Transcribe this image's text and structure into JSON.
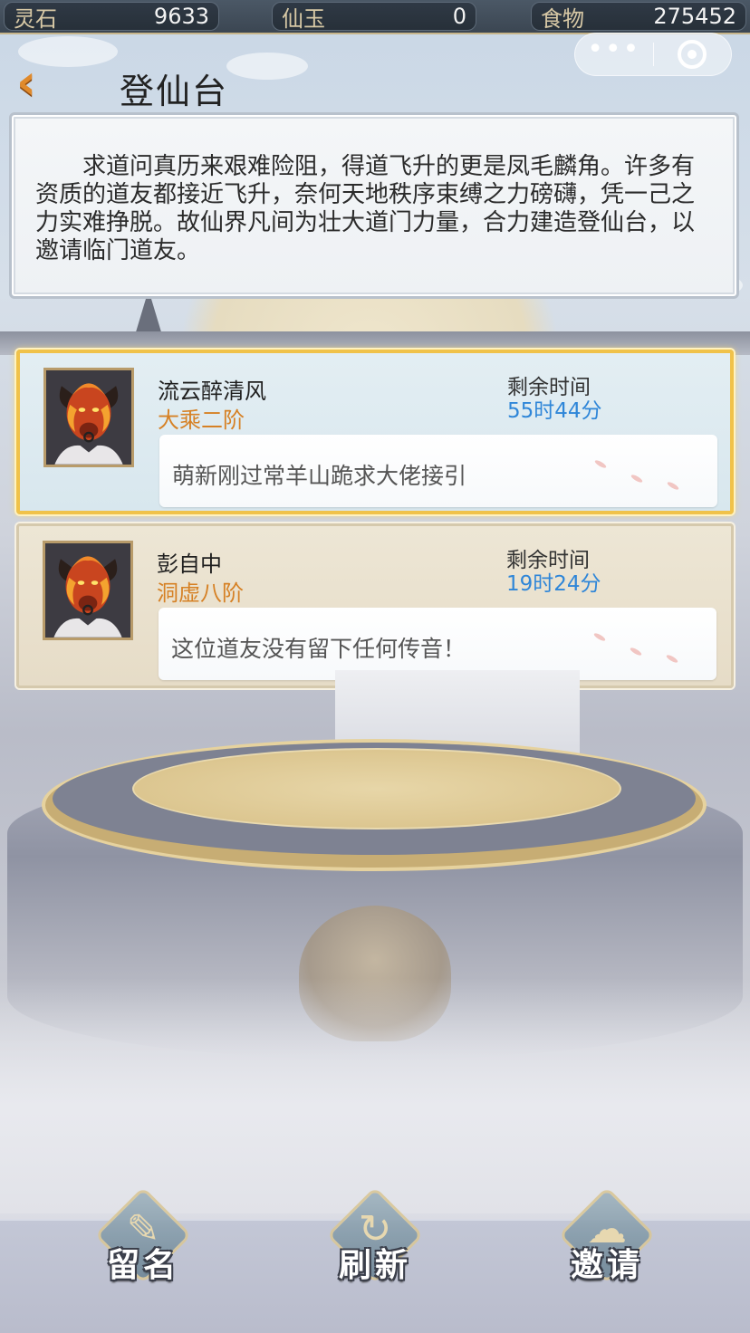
{
  "resources": [
    {
      "label": "灵石",
      "value": "9633"
    },
    {
      "label": "仙玉",
      "value": "0"
    },
    {
      "label": "食物",
      "value": "275452"
    }
  ],
  "capsule": {
    "more_icon": "more-dots-icon",
    "close_icon": "close-circle-icon"
  },
  "header": {
    "title": "登仙台",
    "back_icon": "back-arrow-icon"
  },
  "description": "求道问真历来艰难险阻，得道飞升的更是凤毛麟角。许多有资质的道友都接近飞升，奈何天地秩序束缚之力磅礴，凭一己之力实难挣脱。故仙界凡间为壮大道门力量，合力建造登仙台，以邀请临门道友。",
  "cards": [
    {
      "name": "流云醉清风",
      "rank": "大乘二阶",
      "remain_label": "剩余时间",
      "remain_value": "55时44分",
      "message": "萌新刚过常羊山跪求大佬接引",
      "selected": true
    },
    {
      "name": "彭自中",
      "rank": "洞虚八阶",
      "remain_label": "剩余时间",
      "remain_value": "19时24分",
      "message": "这位道友没有留下任何传音！",
      "selected": false
    }
  ],
  "bottom_buttons": [
    {
      "label": "留名",
      "icon": "scroll-brush-icon"
    },
    {
      "label": "刷新",
      "icon": "refresh-swirl-icon"
    },
    {
      "label": "邀请",
      "icon": "invite-cloud-icon"
    }
  ],
  "colors": {
    "accent_gold": "#f0c24a",
    "rank_orange": "#d68125",
    "time_blue": "#2f86d8",
    "back_orange": "#e08a2c"
  }
}
